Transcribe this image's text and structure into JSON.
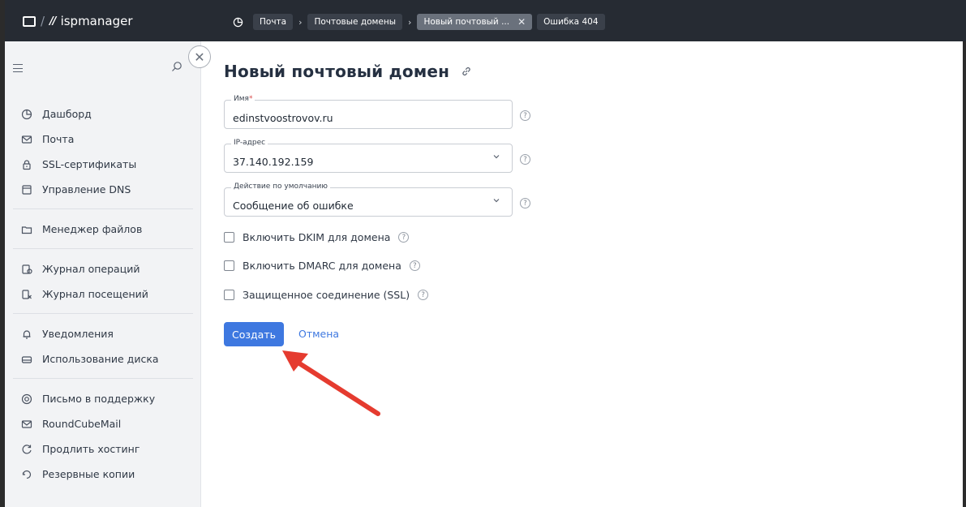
{
  "app": {
    "brand": "ispmanager",
    "mark": "//"
  },
  "breadcrumbs": [
    {
      "label": "Почта"
    },
    {
      "label": "Почтовые домены"
    },
    {
      "label": "Новый почтовый ...",
      "active": true
    },
    {
      "label": "Ошибка 404"
    }
  ],
  "sidebar": {
    "groups": [
      [
        {
          "label": "Дашборд",
          "icon": "dashboard-icon"
        },
        {
          "label": "Почта",
          "icon": "mail-icon"
        },
        {
          "label": "SSL-сертификаты",
          "icon": "lock-icon"
        },
        {
          "label": "Управление DNS",
          "icon": "dns-icon"
        }
      ],
      [
        {
          "label": "Менеджер файлов",
          "icon": "folder-icon"
        }
      ],
      [
        {
          "label": "Журнал операций",
          "icon": "operations-log-icon"
        },
        {
          "label": "Журнал посещений",
          "icon": "visits-log-icon"
        }
      ],
      [
        {
          "label": "Уведомления",
          "icon": "bell-icon"
        },
        {
          "label": "Использование диска",
          "icon": "disk-icon"
        }
      ],
      [
        {
          "label": "Письмо в поддержку",
          "icon": "support-icon"
        },
        {
          "label": "RoundCubeMail",
          "icon": "mail-icon"
        },
        {
          "label": "Продлить хостинг",
          "icon": "refresh-icon"
        },
        {
          "label": "Резервные копии",
          "icon": "backup-icon"
        }
      ]
    ]
  },
  "form": {
    "title": "Новый почтовый домен",
    "name": {
      "label": "Имя",
      "required_mark": "*",
      "value": "edinstvoostrovov.ru"
    },
    "ip": {
      "label": "IP-адрес",
      "value": "37.140.192.159"
    },
    "default_action": {
      "label": "Действие по умолчанию",
      "value": "Сообщение об ошибке"
    },
    "checkboxes": [
      {
        "label": "Включить DKIM для домена",
        "checked": false
      },
      {
        "label": "Включить DMARC для домена",
        "checked": false
      },
      {
        "label": "Защищенное соединение (SSL)",
        "checked": false
      }
    ],
    "help_glyph": "?",
    "submit_label": "Создать",
    "cancel_label": "Отмена"
  },
  "colors": {
    "accent": "#3e78e0",
    "topbar": "#262b33",
    "arrow": "#e53b2f"
  }
}
